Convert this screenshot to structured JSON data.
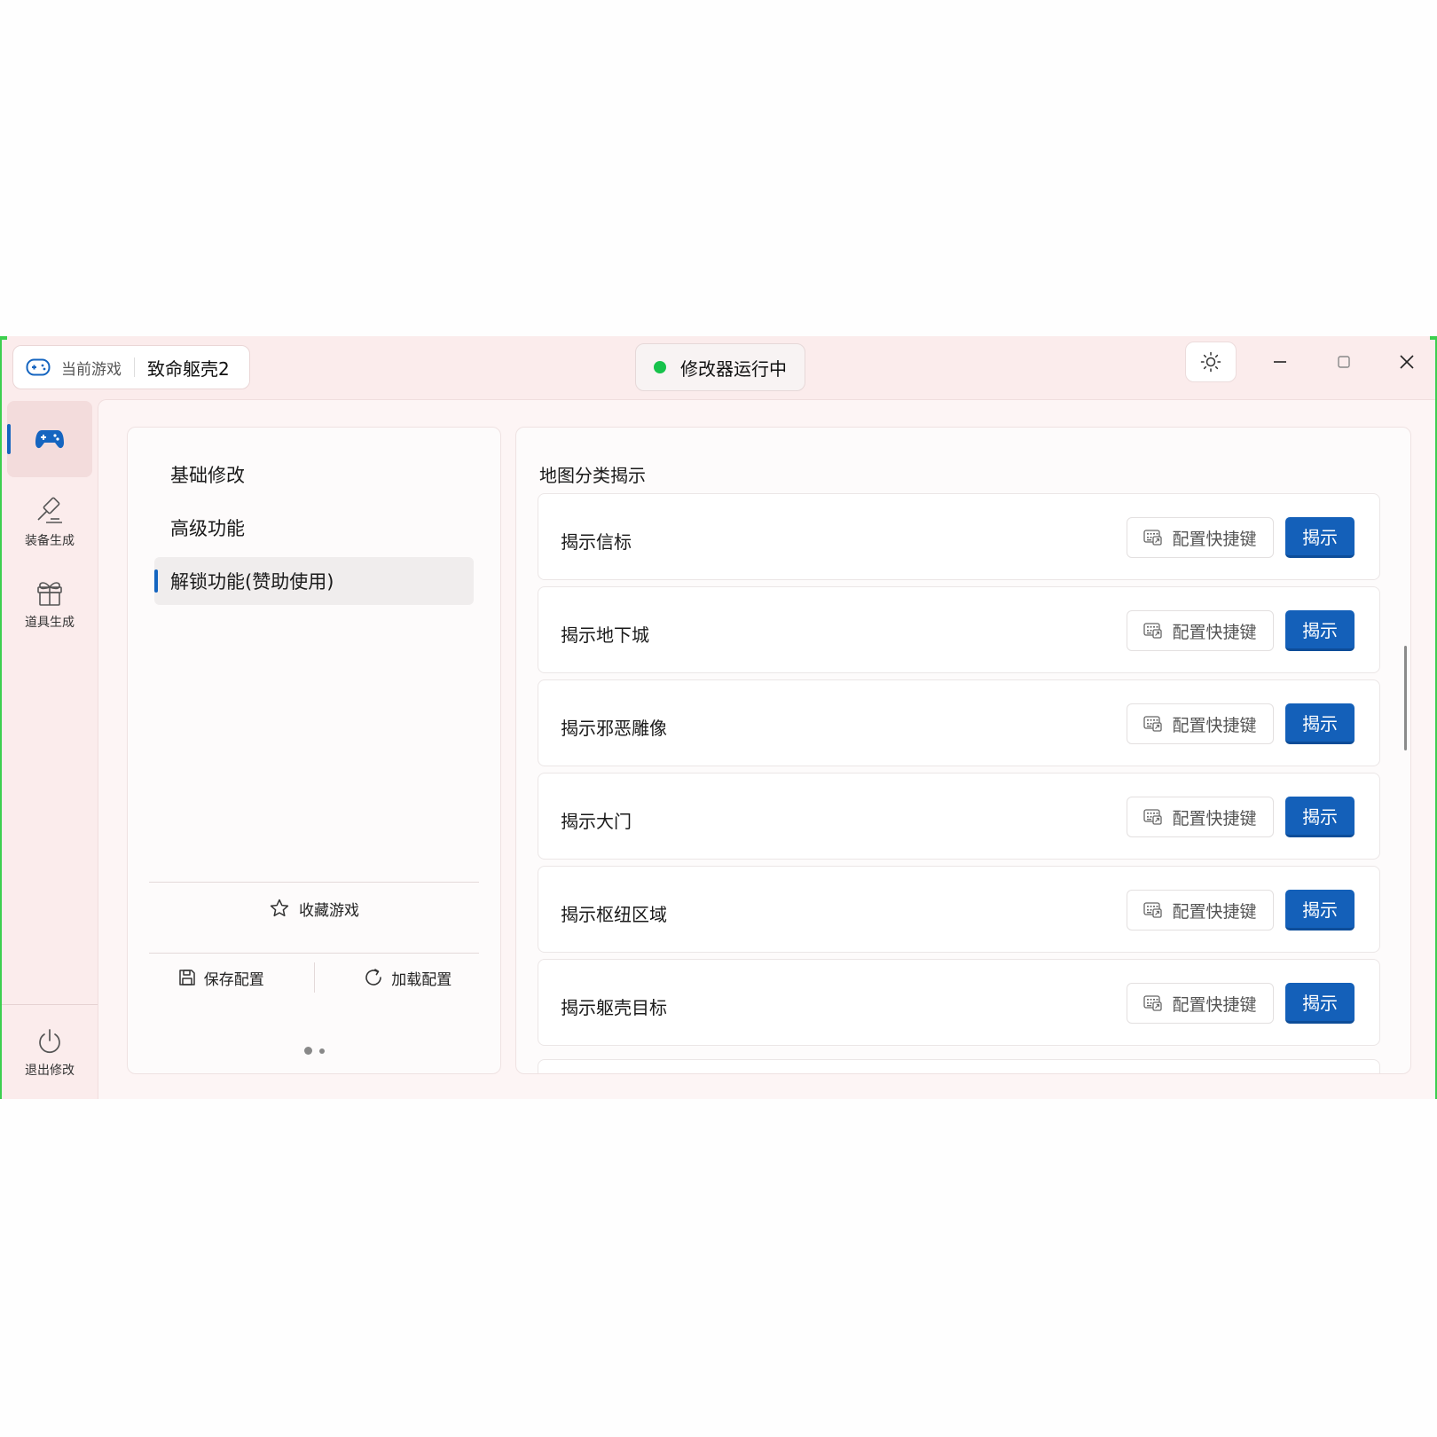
{
  "titlebar": {
    "current_game_label": "当前游戏",
    "game_name": "致命躯壳2",
    "status_text": "修改器运行中",
    "status_color": "#17c24b"
  },
  "rail": {
    "items": [
      {
        "label": "",
        "icon": "gamepad-icon",
        "active": true
      },
      {
        "label": "装备生成",
        "icon": "gavel-icon"
      },
      {
        "label": "道具生成",
        "icon": "gift-icon"
      }
    ],
    "exit_label": "退出修改"
  },
  "left_panel": {
    "nav": [
      {
        "label": "基础修改"
      },
      {
        "label": "高级功能"
      },
      {
        "label": "解锁功能(赞助使用)",
        "active": true
      }
    ],
    "favorite_label": "收藏游戏",
    "save_label": "保存配置",
    "load_label": "加载配置"
  },
  "right_panel": {
    "section_title": "地图分类揭示",
    "hotkey_label": "配置快捷键",
    "reveal_label": "揭示",
    "rows": [
      {
        "label": "揭示信标"
      },
      {
        "label": "揭示地下城"
      },
      {
        "label": "揭示邪恶雕像"
      },
      {
        "label": "揭示大门"
      },
      {
        "label": "揭示枢纽区域"
      },
      {
        "label": "揭示躯壳目标"
      }
    ]
  },
  "colors": {
    "accent": "#1460b9",
    "window_bg": "#fbecec",
    "border_green": "#3ccf4e"
  }
}
